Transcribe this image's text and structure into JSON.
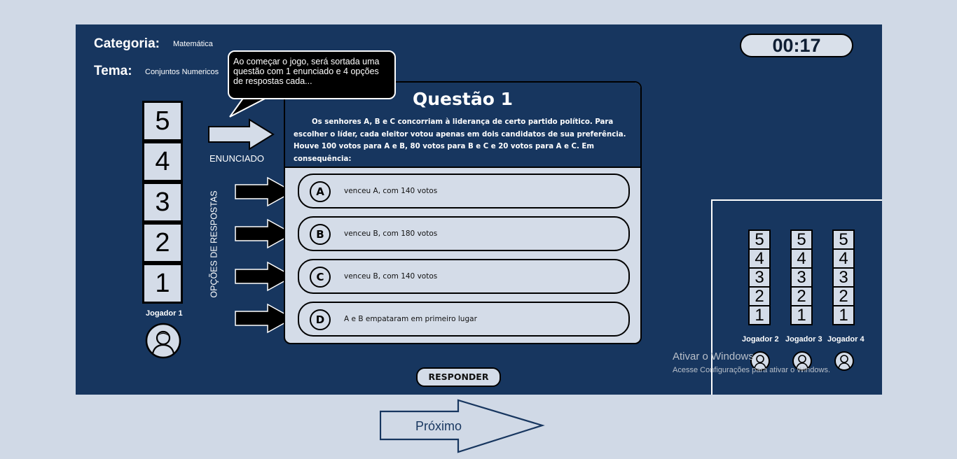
{
  "header": {
    "categoria_label": "Categoria:",
    "categoria_value": "Matemática",
    "tema_label": "Tema:",
    "tema_value": "Conjuntos Numericos"
  },
  "timer": "00:17",
  "tooltip": "Ao começar o jogo, será sortada uma questão com 1 enunciado e 4 opções de respostas cada...",
  "labels": {
    "enunciado": "ENUNCIADO",
    "opcoes": "OPÇÕES DE RESPOSTAS"
  },
  "player1": {
    "name": "Jogador 1",
    "scores": [
      "5",
      "4",
      "3",
      "2",
      "1"
    ]
  },
  "question": {
    "title": "Questão 1",
    "text": "Os senhores A, B e C concorriam à liderança de certo partido político. Para escolher o líder, cada eleitor votou apenas em dois candidatos de sua preferência. Houve 100 votos para A e B, 80 votos para B e C e 20 votos para A e C. Em consequência:",
    "options": [
      {
        "letter": "A",
        "text": "venceu A, com 140 votos"
      },
      {
        "letter": "B",
        "text": "venceu B, com 180 votos"
      },
      {
        "letter": "C",
        "text": "venceu B, com 140 votos"
      },
      {
        "letter": "D",
        "text": "A e B empataram em primeiro lugar"
      }
    ]
  },
  "respond_button": "RESPONDER",
  "other_players": [
    {
      "name": "Jogador 2",
      "scores": [
        "5",
        "4",
        "3",
        "2",
        "1"
      ]
    },
    {
      "name": "Jogador 3",
      "scores": [
        "5",
        "4",
        "3",
        "2",
        "1"
      ]
    },
    {
      "name": "Jogador 4",
      "scores": [
        "5",
        "4",
        "3",
        "2",
        "1"
      ]
    }
  ],
  "watermark": {
    "line1": "Ativar o Windows",
    "line2": "Acesse Configurações para ativar o Windows."
  },
  "next_button": "Próximo",
  "colors": {
    "background": "#d0d9e6",
    "panel": "#17365f",
    "card": "#d4dce8"
  }
}
